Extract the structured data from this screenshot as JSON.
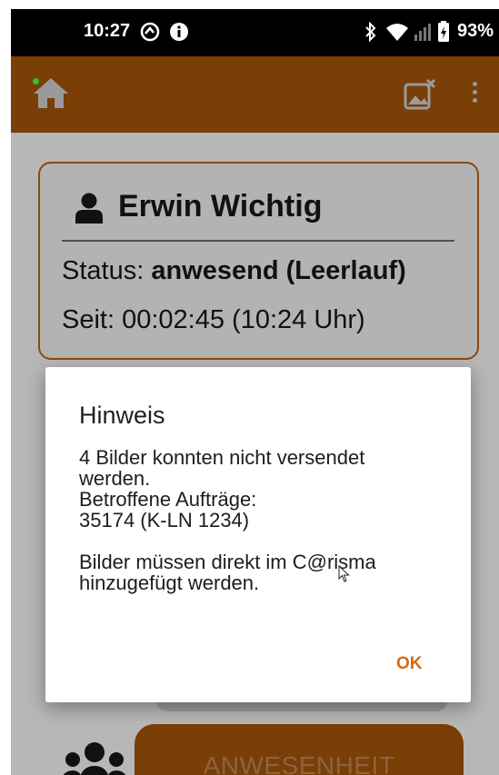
{
  "status_bar": {
    "time": "10:27",
    "battery": "93%",
    "icons": [
      "sync-icon",
      "info-icon",
      "bluetooth-icon",
      "wifi-icon",
      "signal-icon",
      "battery-icon"
    ]
  },
  "app_bar": {
    "color": "#7a3e07",
    "icons": [
      "home-icon",
      "image-error-icon",
      "more-vert-icon"
    ]
  },
  "employee_card": {
    "name": "Erwin Wichtig",
    "status_label": "Status: ",
    "status_value": "anwesend (Leerlauf)",
    "since": "Seit: 00:02:45 (10:24 Uhr)"
  },
  "background": {
    "presence_button": "ANWESENHEIT"
  },
  "dialog": {
    "title": "Hinweis",
    "lines": [
      "4 Bilder konnten nicht versendet",
      "werden.",
      "Betroffene Aufträge:",
      "35174 (K-LN 1234)",
      "",
      "Bilder müssen direkt im C@risma",
      "hinzugefügt werden."
    ],
    "ok_label": "OK",
    "accent": "#d66a10"
  }
}
